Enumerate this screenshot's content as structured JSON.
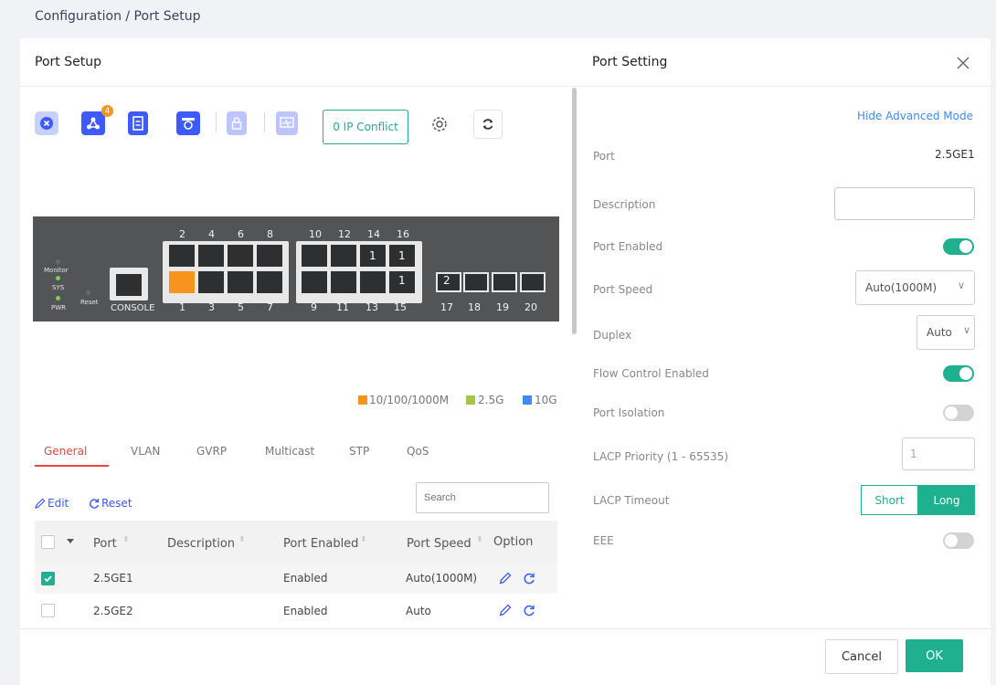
{
  "breadcrumb": "Configuration / Port Setup",
  "left_panel": {
    "title": "Port Setup"
  },
  "toolbar": {
    "ip_conflict": "0 IP Conflict",
    "badge_count": "4"
  },
  "switch": {
    "top_numbers": [
      "2",
      "4",
      "6",
      "8",
      "10",
      "12",
      "14",
      "16"
    ],
    "bottom_numbers": [
      "1",
      "3",
      "5",
      "7",
      "9",
      "11",
      "13",
      "15",
      "17",
      "18",
      "19",
      "20"
    ],
    "port_badges": [
      "1",
      "1",
      "1",
      "2"
    ],
    "labels": {
      "monitor": "Monitor",
      "sys": "SYS",
      "pwr": "PWR",
      "reset": "Reset",
      "console": "CONSOLE"
    }
  },
  "legend": [
    {
      "label": "10/100/1000M",
      "color": "#f7941d"
    },
    {
      "label": "2.5G",
      "color": "#a3c644"
    },
    {
      "label": "10G",
      "color": "#3d8bfd"
    }
  ],
  "tabs": [
    "General",
    "VLAN",
    "GVRP",
    "Multicast",
    "STP",
    "QoS"
  ],
  "actions": {
    "edit": "Edit",
    "reset": "Reset",
    "search_placeholder": "Search"
  },
  "table": {
    "columns": [
      "Port",
      "Description",
      "Port Enabled",
      "Port Speed",
      "Option"
    ],
    "rows": [
      {
        "port": "2.5GE1",
        "description": "",
        "enabled": "Enabled",
        "speed": "Auto(1000M)",
        "checked": true
      },
      {
        "port": "2.5GE2",
        "description": "",
        "enabled": "Enabled",
        "speed": "Auto",
        "checked": false
      }
    ]
  },
  "right_panel": {
    "title": "Port Setting",
    "advanced_link": "Hide Advanced Mode",
    "port_label": "Port",
    "port_value": "2.5GE1",
    "description_label": "Description",
    "port_enabled_label": "Port Enabled",
    "port_speed_label": "Port Speed",
    "port_speed_value": "Auto(1000M)",
    "duplex_label": "Duplex",
    "duplex_value": "Auto",
    "flow_control_label": "Flow Control Enabled",
    "isolation_label": "Port Isolation",
    "lacp_priority_label": "LACP Priority (1 - 65535)",
    "lacp_priority_value": "1",
    "lacp_timeout_label": "LACP Timeout",
    "lacp_short": "Short",
    "lacp_long": "Long",
    "eee_label": "EEE"
  },
  "footer": {
    "cancel": "Cancel",
    "ok": "OK"
  },
  "colors": {
    "accent": "#1fb18f",
    "brand": "#3d5afe",
    "active_tab": "#e8463f"
  }
}
